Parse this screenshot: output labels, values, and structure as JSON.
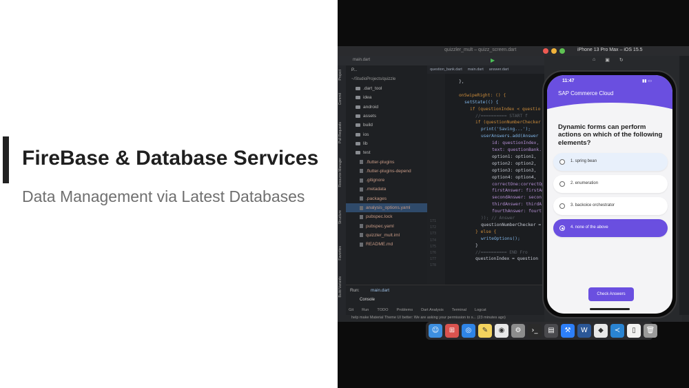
{
  "slide": {
    "title": "FireBase & Database Services",
    "subtitle": "Data Management via Latest Databases"
  },
  "mac": {
    "ide_window_title": "quizzler_mult – quizz_screen.dart",
    "simulator_title": "iPhone 13 Pro Max – iOS 15.5"
  },
  "ide": {
    "run_config": "main.dart",
    "project_label": "P...",
    "project_root": "~/StudioProjects/quizzle",
    "tree": [
      {
        "name": ".dart_tool",
        "type": "folder"
      },
      {
        "name": "idea",
        "type": "folder"
      },
      {
        "name": "android",
        "type": "folder"
      },
      {
        "name": "assets",
        "type": "folder"
      },
      {
        "name": "build",
        "type": "folder"
      },
      {
        "name": "ios",
        "type": "folder"
      },
      {
        "name": "lib",
        "type": "folder"
      },
      {
        "name": "test",
        "type": "folder"
      },
      {
        "name": ".flutter-plugins",
        "type": "file"
      },
      {
        "name": ".flutter-plugins-depend",
        "type": "file"
      },
      {
        "name": ".gitignore",
        "type": "file"
      },
      {
        "name": ".metadata",
        "type": "file"
      },
      {
        "name": ".packages",
        "type": "file"
      },
      {
        "name": "analysis_options.yaml",
        "type": "file"
      },
      {
        "name": "pubspec.lock",
        "type": "file"
      },
      {
        "name": "pubspec.yaml",
        "type": "file"
      },
      {
        "name": "quizzler_mult.iml",
        "type": "file"
      },
      {
        "name": "README.md",
        "type": "file"
      }
    ],
    "editor_tabs": [
      "question_bank.dart",
      "main.dart",
      "answer.dart"
    ],
    "code_lines": [
      "},",
      "",
      "onSwipeRight: () {",
      "setState(() {",
      "if (questionIndex < questio",
      "//========== START f",
      "if (questionNumberChecker",
      "print('Saving...');",
      "userAnswers.add(Answer",
      "id: questionIndex,",
      "text: questionBank.",
      "option1: option1,",
      "option2: option2,",
      "option3: option3,",
      "option4: option4,",
      "correctOne:correctOpt",
      "firstAnswer: firstAns",
      "secondAnswer: secon",
      "thirdAnswer: thirdA",
      "fourthAnswer: fourt",
      ")); // Answer",
      "questionNumberChecker =",
      "} else {",
      "writeOptions();",
      "}",
      "//========== END Fro",
      "questionIndex = question"
    ],
    "line_numbers": [
      "171",
      "172",
      "173",
      "174",
      "175",
      "176",
      "177",
      "178"
    ],
    "run_label": "Run:",
    "run_tab": "main.dart",
    "console_tab": "Console",
    "bottom_tabs": [
      "Git",
      "Run",
      "TODO",
      "Problems",
      "Dart Analysis",
      "Terminal",
      "Logcat"
    ],
    "status_message": "help make Material Theme UI better: We are asking your permission to s... (23 minutes ago)",
    "status_right": "471",
    "vertical_tabs": [
      "Project",
      "Commit",
      "Pull Requests",
      "Resource Manager",
      "Structure",
      "Favorites",
      "Build Variants"
    ]
  },
  "phone": {
    "time": "11:47",
    "app_title": "SAP Commerce Cloud",
    "question": "Dynamic forms can perform actions on which of the following elements?",
    "options": [
      {
        "label": "1. spring bean",
        "state": "hover"
      },
      {
        "label": "2. enumeration",
        "state": "normal"
      },
      {
        "label": "3. backoice orchestrator",
        "state": "normal"
      },
      {
        "label": "4. none of the above",
        "state": "selected"
      }
    ],
    "button": "Check Answers"
  },
  "dock": {
    "icons": [
      "finder-icon",
      "launchpad-icon",
      "safari-icon",
      "notes-icon",
      "chrome-icon",
      "settings-icon",
      "terminal-icon",
      "simulator-icon",
      "xcode-icon",
      "word-icon",
      "android-studio-icon",
      "vscode-icon",
      "document-icon",
      "trash-icon"
    ],
    "colors": [
      "#3d8fe0",
      "#d9534f",
      "#2f84e6",
      "#f4d35e",
      "#e8e8e8",
      "#8c8c8c",
      "#2b2b2b",
      "#4a4a4e",
      "#2d7ff9",
      "#2b5797",
      "#e8e8e8",
      "#2a84d2",
      "#f2f2f2",
      "#9a9a9a"
    ]
  },
  "colors": {
    "accent": "#6a4fe0",
    "title": "#1f1f1f",
    "subtitle": "#6f6f6f"
  }
}
